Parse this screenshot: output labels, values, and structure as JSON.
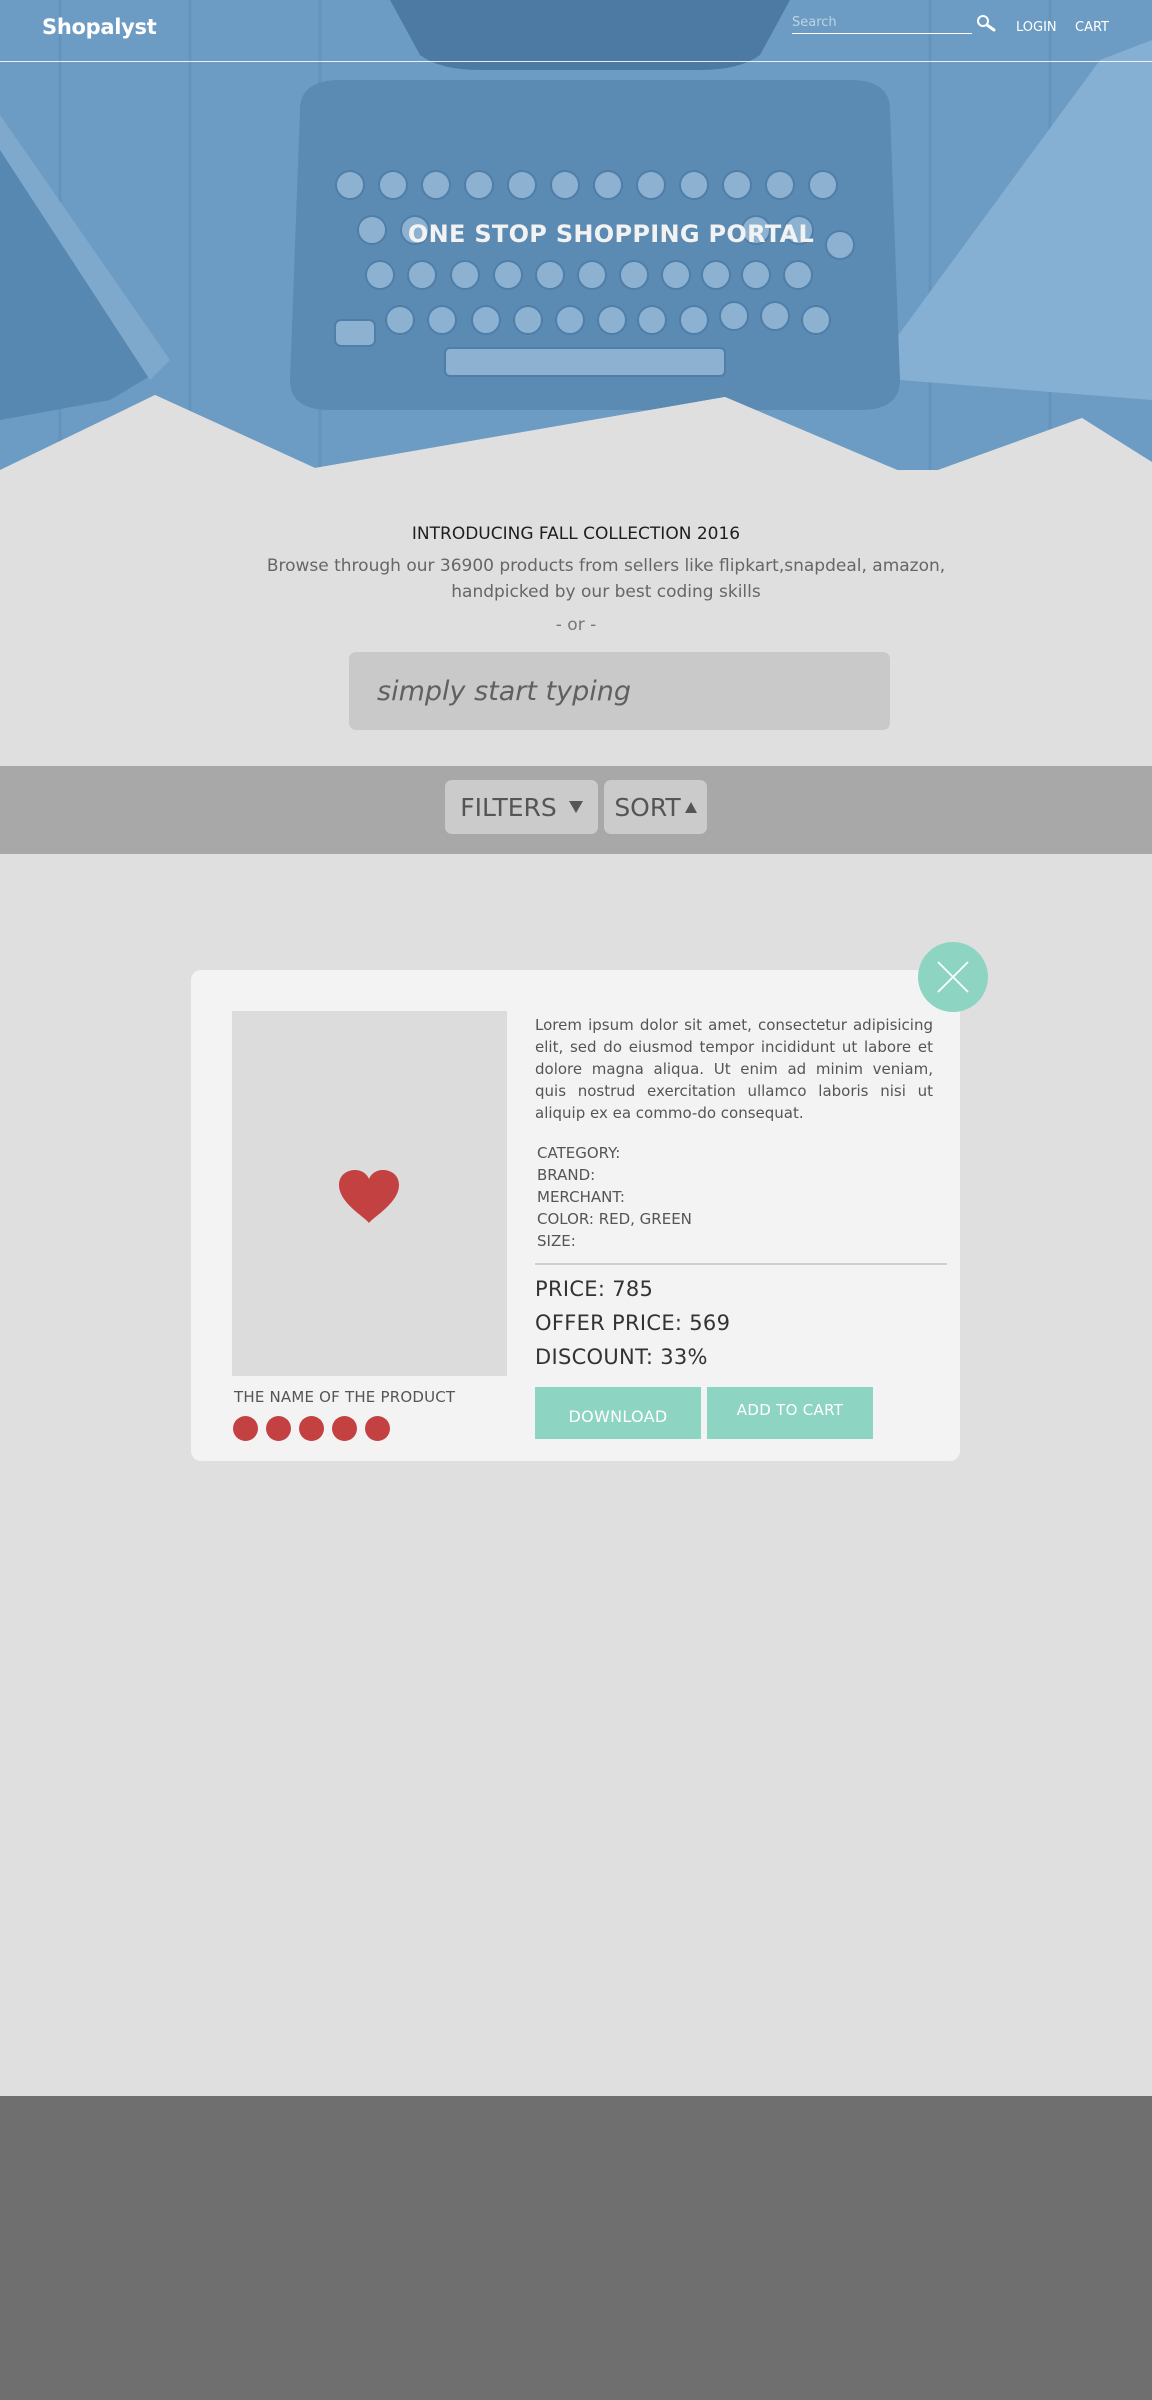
{
  "nav": {
    "logo": "Shopalyst",
    "search_placeholder": "Search",
    "search_icon": "search-icon",
    "login_label": "LOGIN",
    "cart_label": "CART"
  },
  "hero": {
    "title": "ONE STOP SHOPPING PORTAL"
  },
  "intro": {
    "heading": "INTRODUCING FALL COLLECTION 2016",
    "description": "Browse through our 36900 products from sellers like flipkart,snapdeal, amazon, handpicked by our best coding skills",
    "or_text": "- or -",
    "search_placeholder": "simply start typing"
  },
  "toolbar": {
    "filters_label": "FILTERS",
    "sort_label": "SORT"
  },
  "product": {
    "image_icon": "heart-icon",
    "name": "THE NAME OF THE PRODUCT",
    "rating": 5,
    "description": "Lorem ipsum dolor sit amet, consectetur adipisicing elit, sed do eiusmod tempor incididunt ut labore et dolore magna aliqua. Ut enim ad minim veniam, quis nostrud exercitation ullamco laboris nisi ut aliquip ex ea commo-do consequat.",
    "category": "CATEGORY:",
    "brand": "BRAND:",
    "merchant": "MERCHANT:",
    "color": "COLOR: RED, GREEN",
    "size": "SIZE:",
    "price": "PRICE: 785",
    "offer_price": "OFFER PRICE: 569",
    "discount": "DISCOUNT: 33%",
    "download_label": "DOWNLOAD",
    "add_to_cart_label": "ADD TO CART"
  },
  "colors": {
    "accent": "#8dd5c2",
    "rating": "#c44142",
    "hero_blue": "#6c9cc3",
    "page_bg": "#dfdfdf",
    "filter_bar": "#a8a8a8",
    "footer": "#6f6f6f"
  }
}
